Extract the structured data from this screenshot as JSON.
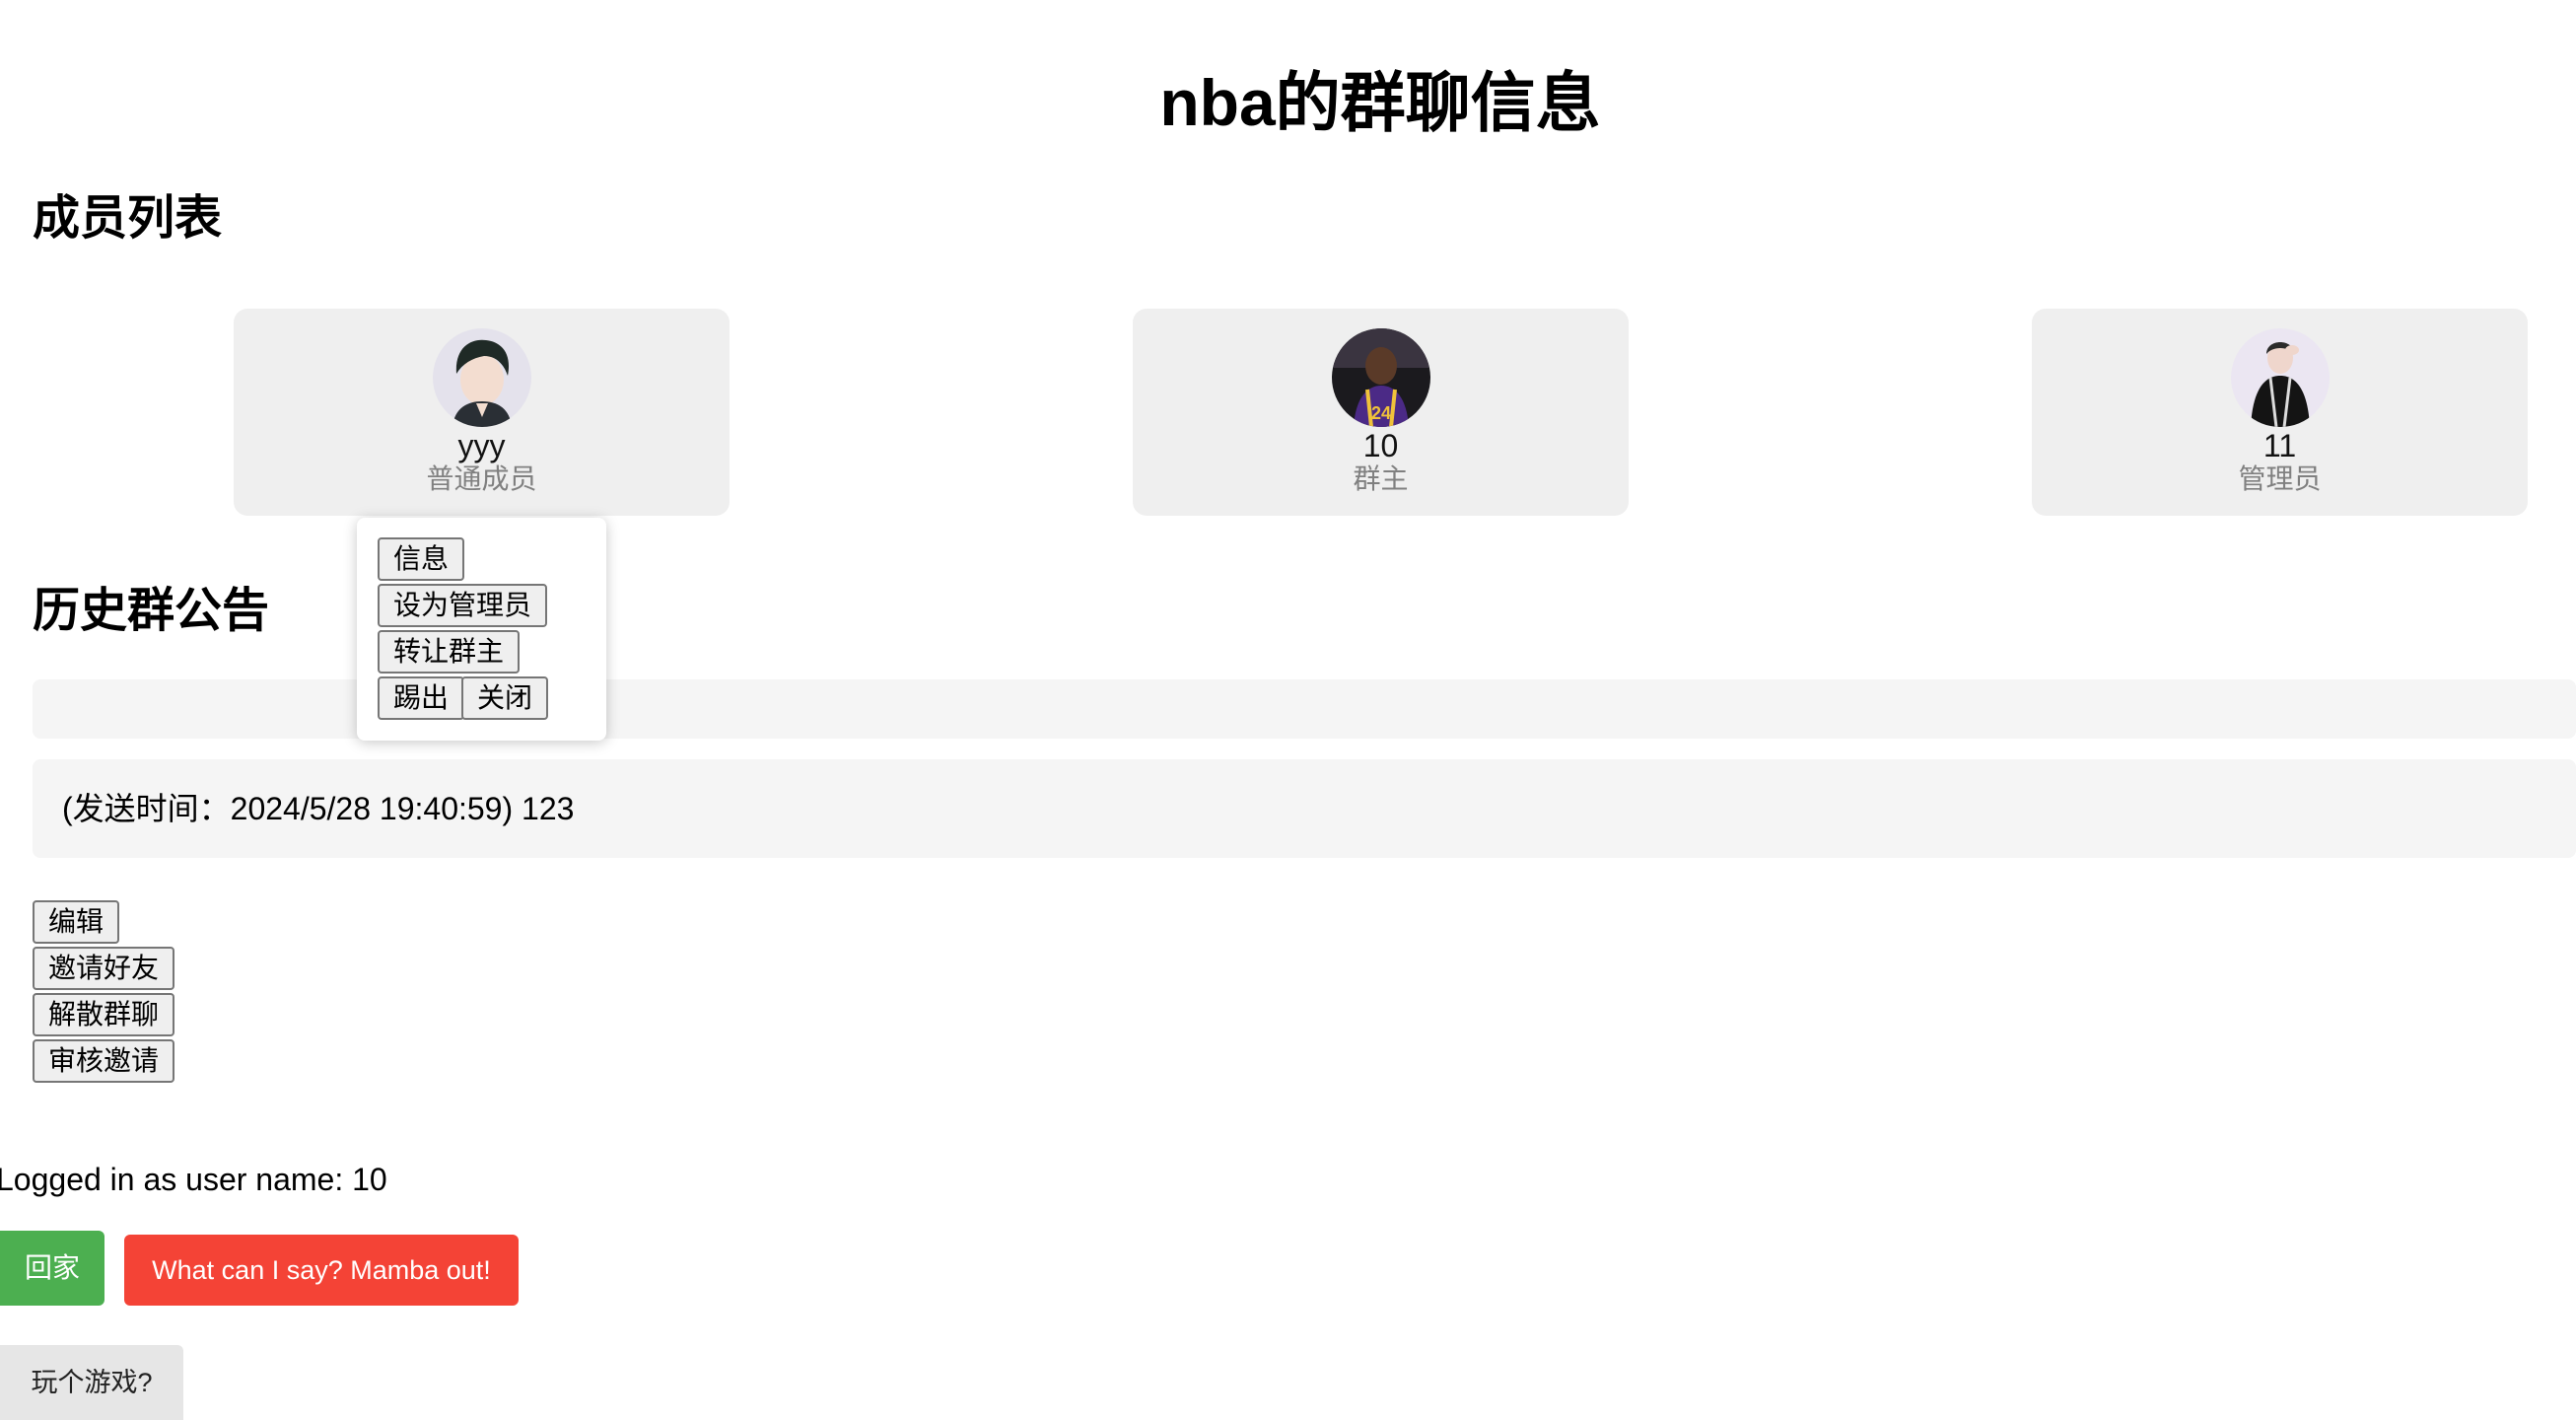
{
  "page": {
    "title": "nba的群聊信息"
  },
  "members_section": {
    "title": "成员列表",
    "members": [
      {
        "name": "yyy",
        "role": "普通成员"
      },
      {
        "name": "10",
        "role": "群主"
      },
      {
        "name": "11",
        "role": "管理员"
      }
    ]
  },
  "popup_menu": {
    "info_label": "信息",
    "set_admin_label": "设为管理员",
    "transfer_owner_label": "转让群主",
    "kick_label": "踢出",
    "close_label": "关闭"
  },
  "notices_section": {
    "title": "历史群公告",
    "notices": [
      {
        "text": ""
      },
      {
        "text": "(发送时间：2024/5/28 19:40:59) 123"
      }
    ]
  },
  "group_actions": {
    "edit_label": "编辑",
    "invite_label": "邀请好友",
    "dissolve_label": "解散群聊",
    "review_label": "审核邀请"
  },
  "footer": {
    "login_status": "Logged in as user name: 10",
    "home_label": "回家",
    "mamba_label": "What can I say? Mamba out!",
    "game_label": "玩个游戏?"
  },
  "colors": {
    "home_button": "#4caf50",
    "mamba_button": "#f44336",
    "card_background": "#efefef",
    "role_text": "#808080"
  },
  "icons": {
    "member_1_avatar": "avatar-photo-young-man",
    "member_2_avatar": "avatar-photo-basketball-player",
    "member_3_avatar": "avatar-photo-performer"
  }
}
